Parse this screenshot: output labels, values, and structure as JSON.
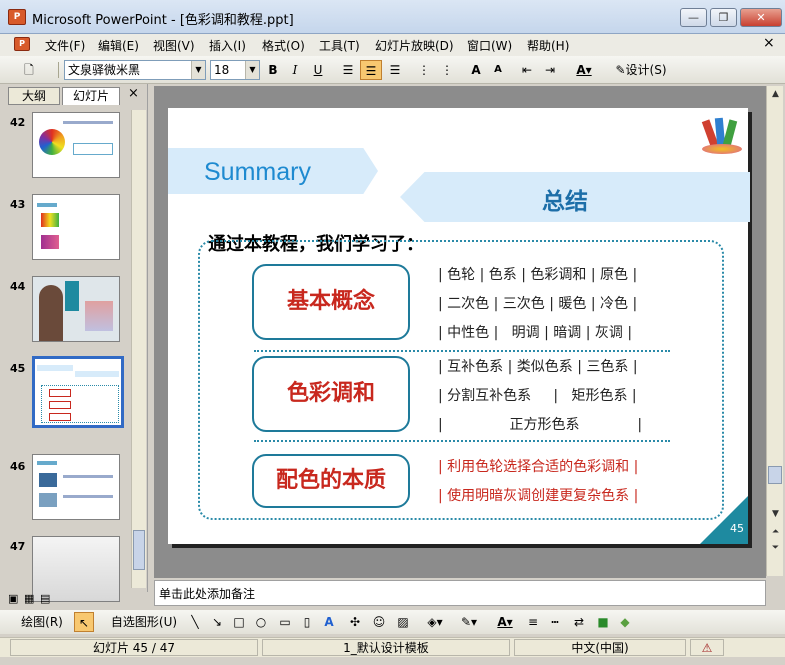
{
  "window": {
    "app_icon": "P",
    "title": "Microsoft PowerPoint - [色彩调和教程.ppt]",
    "minimize": "—",
    "restore": "❐",
    "close": "✕"
  },
  "menu": [
    "文件(F)",
    "编辑(E)",
    "视图(V)",
    "插入(I)",
    "格式(O)",
    "工具(T)",
    "幻灯片放映(D)",
    "窗口(W)",
    "帮助(H)"
  ],
  "toolbar": {
    "font": "文泉驿微米黑",
    "size": "18",
    "bold": "B",
    "italic": "I",
    "underline": "U",
    "design": "设计(S)"
  },
  "panes": {
    "tab_outline": "大纲",
    "tab_slides": "幻灯片",
    "close": "×"
  },
  "thumbnails": [
    {
      "num": "42"
    },
    {
      "num": "43"
    },
    {
      "num": "44"
    },
    {
      "num": "45",
      "selected": true
    },
    {
      "num": "46"
    },
    {
      "num": "47"
    }
  ],
  "slide": {
    "summary": "Summary",
    "title": "总结",
    "intro": "通过本教程，我们学习了：",
    "sections": [
      {
        "name": "基本概念",
        "lines": [
          "| 色轮 | 色系 | 色彩调和 | 原色 |",
          "| 二次色 | 三次色 | 暖色 | 冷色 |",
          "| 中性色 |   明调 | 暗调 | 灰调 |"
        ]
      },
      {
        "name": "色彩调和",
        "lines": [
          "| 互补色系 | 类似色系 | 三色系 |",
          "| 分割互补色系     |   矩形色系 |",
          "|               正方形色系             |"
        ]
      },
      {
        "name": "配色的本质",
        "lines": [
          "| 利用色轮选择合适的色彩调和 |",
          "| 使用明暗灰调创建更复杂色系 |"
        ]
      }
    ],
    "page_number": "45"
  },
  "notes_placeholder": "单击此处添加备注",
  "drawbar": {
    "draw": "绘图(R)",
    "autoshapes": "自选图形(U)"
  },
  "status": {
    "slide": "幻灯片 45 / 47",
    "template": "1_默认设计模板",
    "language": "中文(中国)"
  },
  "colors": {
    "accent": "#1e8ad0",
    "highlight": "#c8281e",
    "frame": "#1e7a9a"
  }
}
